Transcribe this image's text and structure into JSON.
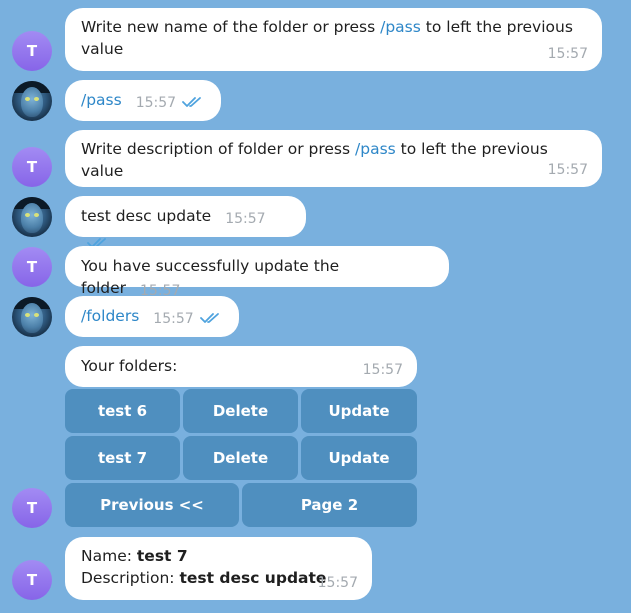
{
  "messages": {
    "m1": {
      "text_a": "Write new name of the folder or press ",
      "cmd": "/pass",
      "text_b": " to left the previous value",
      "time": "15:57"
    },
    "m2": {
      "cmd": "/pass",
      "time": "15:57"
    },
    "m3": {
      "text_a": "Write description of folder or press ",
      "cmd": "/pass",
      "text_b": " to left the previous value",
      "time": "15:57"
    },
    "m4": {
      "text": "test desc update",
      "time": "15:57"
    },
    "m5": {
      "text": "You have successfully update the folder",
      "time": "15:57"
    },
    "m6": {
      "cmd": "/folders",
      "time": "15:57"
    },
    "m7": {
      "text": "Your folders:",
      "time": "15:57"
    },
    "m8": {
      "name_label": "Name: ",
      "name_value": "test 7",
      "desc_label": "Description: ",
      "desc_value": "test desc update",
      "time": "15:57"
    }
  },
  "avatars": {
    "bot_letter": "T"
  },
  "keyboard": {
    "rows": [
      [
        "test 6",
        "Delete",
        "Update"
      ],
      [
        "test 7",
        "Delete",
        "Update"
      ],
      [
        "Previous <<",
        "Page 2"
      ]
    ]
  },
  "colors": {
    "background": "#79b0de",
    "bubble": "#ffffff",
    "command_link": "#2e87c8",
    "keyboard_button": "#4f8fbf",
    "bot_avatar": "#8f70ec",
    "read_ticks": "#4fa3de"
  },
  "icons": {
    "read_receipt": "double-check-icon"
  }
}
